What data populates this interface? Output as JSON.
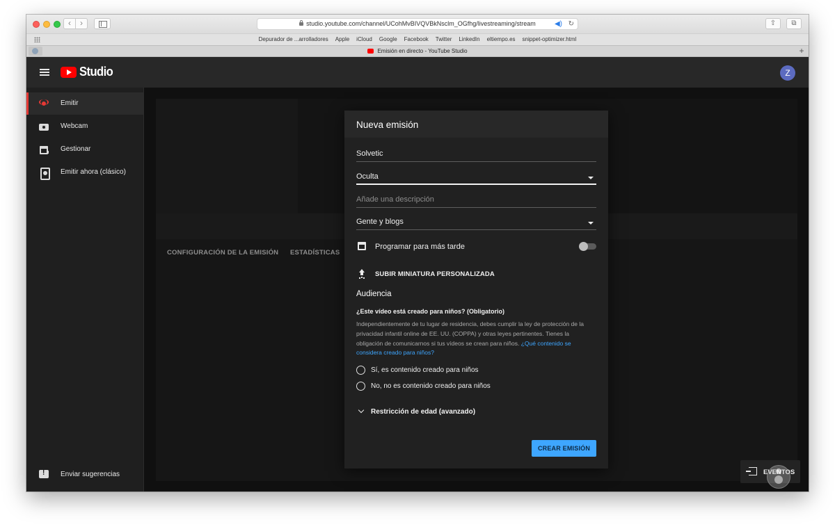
{
  "browser": {
    "url": "studio.youtube.com/channel/UCohMvBIVQVBkNsclm_OGfhg/livestreaming/stream",
    "bookmarks": [
      "Depurador de ...arrolladores",
      "Apple",
      "iCloud",
      "Google",
      "Facebook",
      "Twitter",
      "LinkedIn",
      "eltiempo.es",
      "snippet-optimizer.html"
    ],
    "tab_title": "Emisión en directo - YouTube Studio"
  },
  "header": {
    "studio_label": "Studio",
    "avatar_letter": "Z"
  },
  "sidebar": {
    "items": [
      {
        "label": "Emitir",
        "icon": "broadcast-icon",
        "active": true
      },
      {
        "label": "Webcam",
        "icon": "camera-icon"
      },
      {
        "label": "Gestionar",
        "icon": "calendar-icon"
      },
      {
        "label": "Emitir ahora (clásico)",
        "icon": "phone-broadcast-icon"
      }
    ],
    "feedback": {
      "label": "Enviar sugerencias",
      "icon": "feedback-icon"
    }
  },
  "main": {
    "tabs": [
      "CONFIGURACIÓN DE LA EMISIÓN",
      "ESTADÍSTICAS"
    ],
    "eventos_label": "EVENTOS"
  },
  "dialog": {
    "title": "Nueva emisión",
    "title_field": "Solvetic",
    "visibility": "Oculta",
    "description_placeholder": "Añade una descripción",
    "category": "Gente y blogs",
    "schedule_label": "Programar para más tarde",
    "schedule_enabled": false,
    "upload_label": "SUBIR MINIATURA PERSONALIZADA",
    "audience_title": "Audiencia",
    "audience_question": "¿Este vídeo está creado para niños? (Obligatorio)",
    "audience_body": "Independientemente de tu lugar de residencia, debes cumplir la ley de protección de la privacidad infantil online de EE. UU. (COPPA) y otras leyes pertinentes. Tienes la obligación de comunicarnos si tus vídeos se crean para niños.",
    "audience_link": "¿Qué contenido se considera creado para niños?",
    "radio_options": [
      "Sí, es contenido creado para niños",
      "No, no es contenido creado para niños"
    ],
    "age_restriction_label": "Restricción de edad (avanzado)",
    "create_button": "CREAR EMISIÓN"
  },
  "colors": {
    "accent": "#3ea6ff",
    "brand_red": "#ff0000",
    "active_indicator": "#e53935",
    "avatar": "#5c6bc0"
  }
}
